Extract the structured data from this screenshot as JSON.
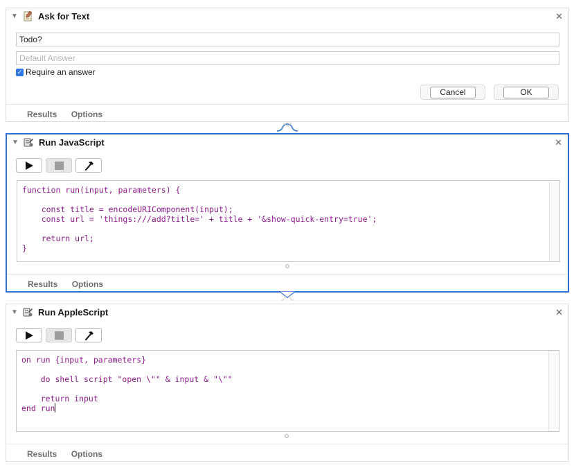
{
  "ask_for_text": {
    "title": "Ask for Text",
    "question_value": "Todo?",
    "default_answer_placeholder": "Default Answer",
    "require_answer_label": "Require an answer",
    "require_answer_checked": true,
    "cancel_label": "Cancel",
    "ok_label": "OK",
    "tabs": {
      "results": "Results",
      "options": "Options"
    }
  },
  "run_javascript": {
    "title": "Run JavaScript",
    "code": "function run(input, parameters) {\n\n    const title = encodeURIComponent(input);\n    const url = 'things:///add?title=' + title + '&show-quick-entry=true';\n\n    return url;\n}",
    "tabs": {
      "results": "Results",
      "options": "Options"
    }
  },
  "run_applescript": {
    "title": "Run AppleScript",
    "code": "on run {input, parameters}\n\n    do shell script \"open \\\"\" & input & \"\\\"\"\n\n    return input\nend run",
    "tabs": {
      "results": "Results",
      "options": "Options"
    }
  },
  "icons": {
    "collapse": "disclosure-triangle-icon",
    "close": "close-icon",
    "run": "play-icon",
    "stop": "stop-icon",
    "compile": "hammer-icon",
    "ask_action": "notepad-icon",
    "script_action": "script-robot-icon"
  },
  "colors": {
    "selected_border": "#2a6fd1",
    "code_text": "#8c1c8c",
    "checkbox": "#2f78e6"
  }
}
